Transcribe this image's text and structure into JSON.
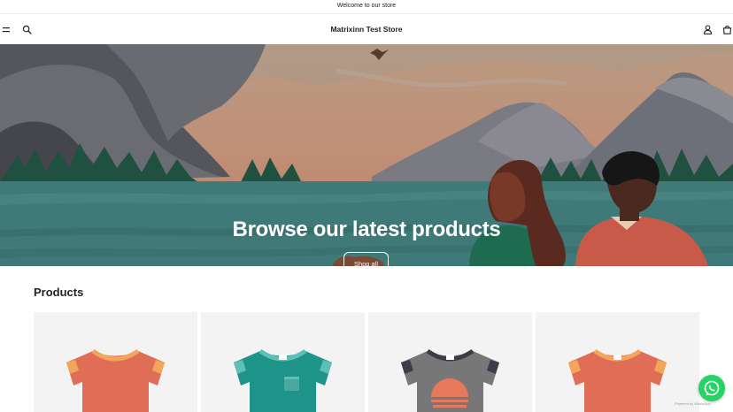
{
  "announcement": {
    "text": "Welcome to our store"
  },
  "header": {
    "store_name": "Matrixinn Test Store",
    "icons": [
      "menu-icon",
      "search-icon",
      "account-icon",
      "cart-icon"
    ]
  },
  "hero": {
    "title": "Browse our latest products",
    "button_label": "Shop all"
  },
  "products_section": {
    "title": "Products",
    "items": [
      {
        "image": "orange-tshirt-icon",
        "color": "#e06d55"
      },
      {
        "image": "teal-tshirt-icon",
        "color": "#1e9389"
      },
      {
        "image": "grey-tshirt-icon",
        "color": "#777777"
      },
      {
        "image": "orange-tshirt-icon",
        "color": "#e06d55"
      }
    ]
  },
  "whatsapp": {
    "icon": "whatsapp-icon",
    "color": "#25d366",
    "powered_text": "Powered by WhatsApp"
  }
}
